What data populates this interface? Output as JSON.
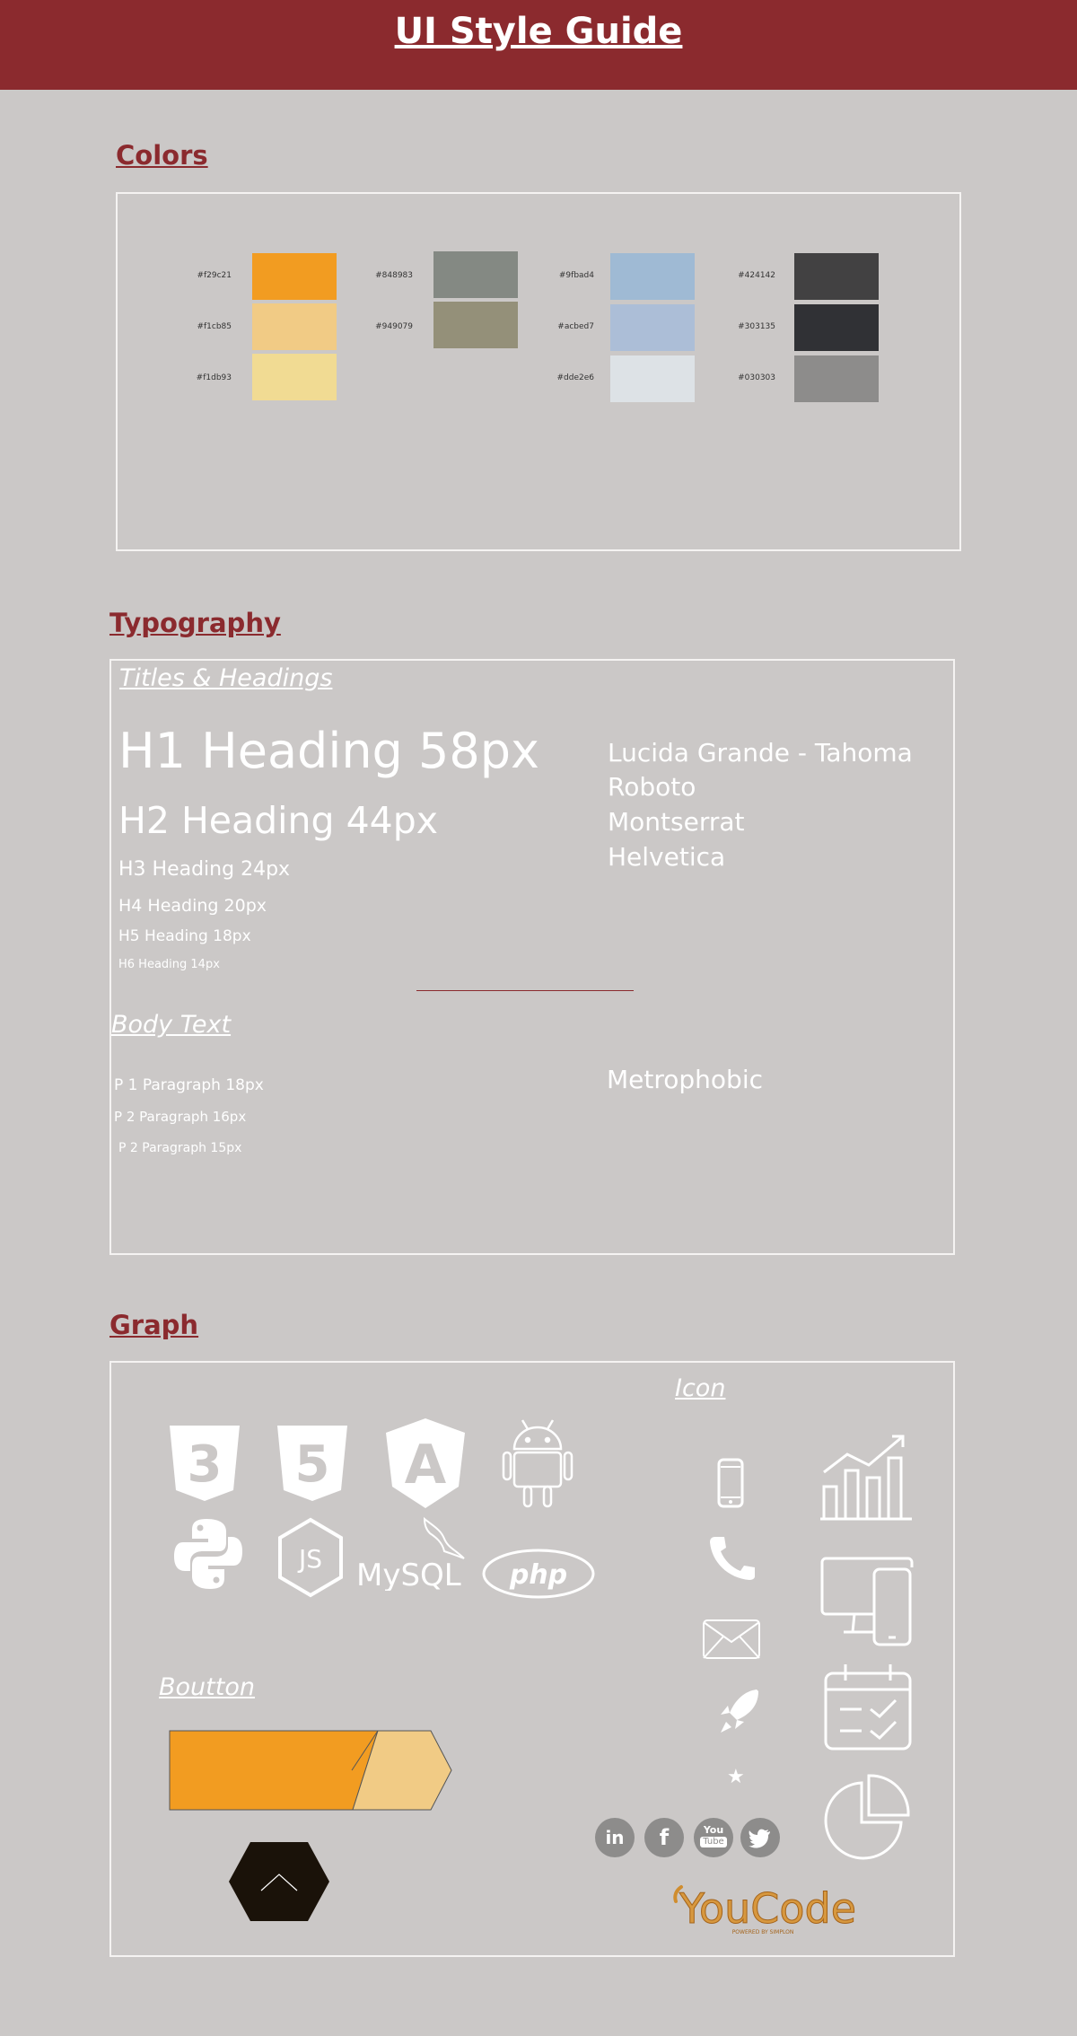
{
  "header": {
    "title": "UI Style Guide"
  },
  "colors_section": {
    "title": "Colors",
    "swatches": [
      {
        "label": "#f29c21",
        "hex": "#f29c21"
      },
      {
        "label": "#f1cb85",
        "hex": "#f1cb85"
      },
      {
        "label": "#f1db93",
        "hex": "#f1db93"
      },
      {
        "label": "#848983",
        "hex": "#848983"
      },
      {
        "label": "#949079",
        "hex": "#949079"
      },
      {
        "label": "#9fbad4",
        "hex": "#9fbad4"
      },
      {
        "label": "#acbed7",
        "hex": "#acbed7"
      },
      {
        "label": "#dde2e6",
        "hex": "#dde2e6"
      },
      {
        "label": "#424142",
        "hex": "#424142"
      },
      {
        "label": "#303135",
        "hex": "#303135"
      },
      {
        "label": "#030303",
        "hex": "#8d8c8b"
      }
    ]
  },
  "typography": {
    "title": "Typography",
    "titles_heading": "Titles & Headings",
    "h1": "H1 Heading 58px",
    "h2": "H2 Heading 44px",
    "h3": "H3 Heading 24px",
    "h4": "H4 Heading 20px",
    "h5": "H5 Heading 18px",
    "h6": "H6 Heading 14px",
    "fonts": [
      "Lucida Grande - Tahoma",
      "Roboto",
      "Montserrat",
      "Helvetica"
    ],
    "body_heading": "Body Text",
    "p1": "P 1  Paragraph 18px",
    "p2": "P 2  Paragraph 16px",
    "p3": "P 2  Paragraph 15px",
    "body_font": "Metrophobic"
  },
  "graph": {
    "title": "Graph",
    "icon_heading": "Icon",
    "button_heading": "Boutton",
    "tech_logos": {
      "css3": "3",
      "html5": "5",
      "angular": "A",
      "nodejs": "JS",
      "mysql": "MySQL",
      "php": "php"
    },
    "social": {
      "linkedin": "in",
      "facebook": "f",
      "youtube_top": "You",
      "youtube_bottom": "Tube"
    },
    "brand_logo": "YouCode",
    "brand_tagline": "POWERED BY SIMPLON",
    "icon_names": [
      "phone-icon",
      "call-icon",
      "mail-icon",
      "rocket-icon",
      "star-icon",
      "bar-chart-icon",
      "devices-icon",
      "checklist-calendar-icon",
      "pie-chart-icon"
    ]
  },
  "accent_colors": {
    "brand": "#8b2a2e",
    "button_orange": "#f29c21",
    "button_light": "#f1cb85",
    "dark_hex": "#1a1209"
  }
}
